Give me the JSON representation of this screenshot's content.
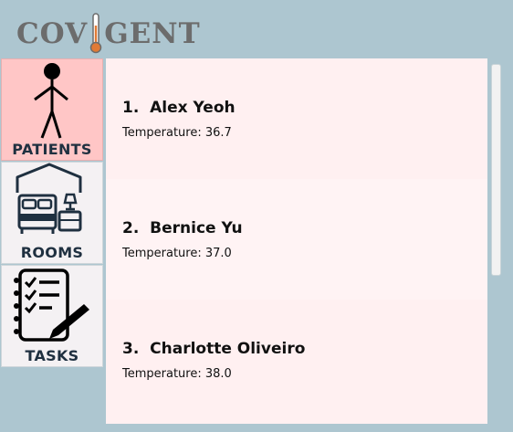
{
  "app": {
    "logo_left": "COV",
    "logo_right": "GENT",
    "logo_icon": "thermometer-icon"
  },
  "nav": {
    "items": [
      {
        "label": "PATIENTS",
        "icon": "person-icon",
        "active": true
      },
      {
        "label": "ROOMS",
        "icon": "bedroom-icon",
        "active": false
      },
      {
        "label": "TASKS",
        "icon": "task-checklist-icon",
        "active": false
      }
    ]
  },
  "patients": [
    {
      "index": "1.",
      "name": "Alex Yeoh",
      "temperature": "Temperature: 36.7"
    },
    {
      "index": "2.",
      "name": "Bernice Yu",
      "temperature": "Temperature: 37.0"
    },
    {
      "index": "3.",
      "name": "Charlotte Oliveiro",
      "temperature": "Temperature: 38.0"
    }
  ],
  "colors": {
    "background": "#adc6d0",
    "active_nav": "#ffc6c6",
    "panel": "#fff0f1",
    "logo_text": "#6c6c6c",
    "thermometer": "#e07a35"
  }
}
